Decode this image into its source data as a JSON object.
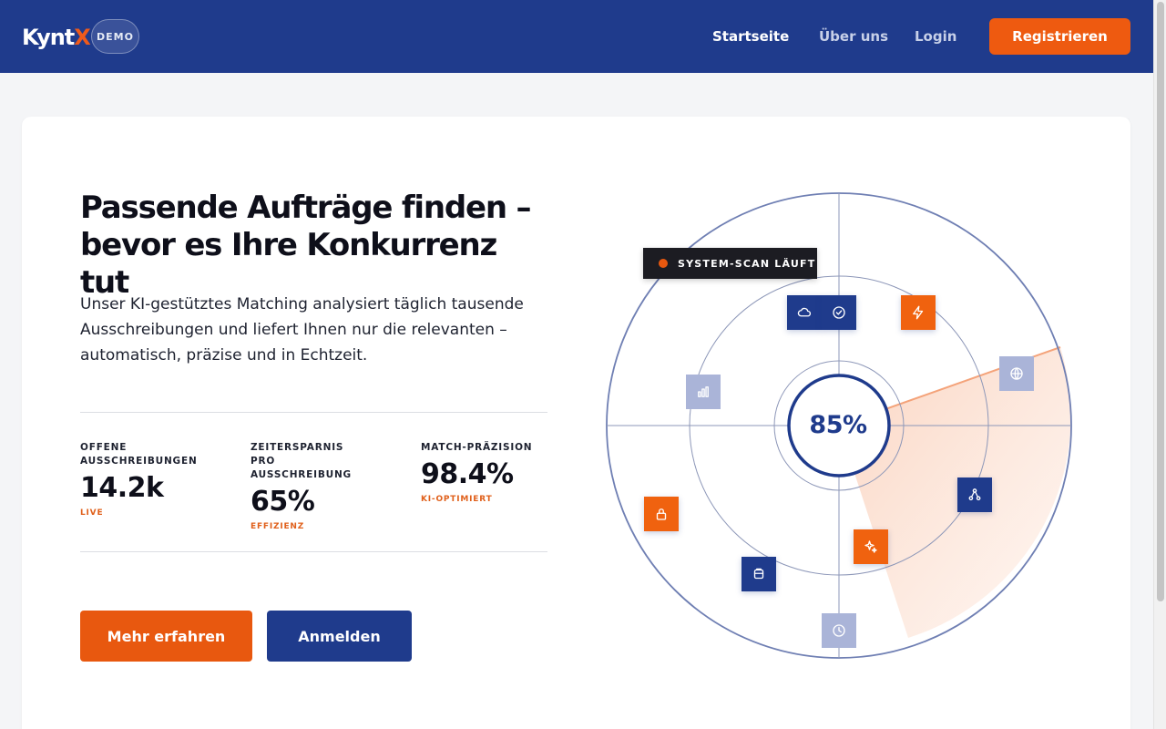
{
  "header": {
    "logo_main": "Kynt",
    "logo_accent": "X",
    "badge": "DEMO",
    "nav": {
      "home": "Startseite",
      "about": "Über uns",
      "login": "Login"
    },
    "register_label": "Registrieren"
  },
  "hero": {
    "headline_line1": "Passende Aufträge finden –",
    "headline_line2": "bevor es Ihre Konkurrenz tut",
    "lead": "Unser KI-gestütztes Matching analysiert täglich tausende Ausschreibungen und liefert Ihnen nur die relevanten – automatisch, präzise und in Echtzeit.",
    "stats": [
      {
        "label": "OFFENE AUSSCHREIBUNGEN",
        "value": "14.2k",
        "sub": "LIVE"
      },
      {
        "label": "ZEITERSPARNIS PRO AUSSCHREIBUNG",
        "value": "65%",
        "sub": "EFFIZIENZ"
      },
      {
        "label": "MATCH-PRÄZISION",
        "value": "98.4%",
        "sub": "KI-OPTIMIERT"
      }
    ],
    "buttons": {
      "more": "Mehr erfahren",
      "signin": "Anmelden"
    }
  },
  "radar": {
    "status": "SYSTEM-SCAN LÄUFT",
    "percent": "85%",
    "nodes": [
      "cloud-icon",
      "check-circle-icon",
      "bolt-icon",
      "globe-icon",
      "bar-chart-icon",
      "network-icon",
      "lock-icon",
      "sparkle-icon",
      "database-icon",
      "clock-icon"
    ]
  },
  "colors": {
    "brand_navy": "#1f3b8c",
    "accent_orange": "#ee5a10",
    "text_dark": "#0e0f1a"
  }
}
